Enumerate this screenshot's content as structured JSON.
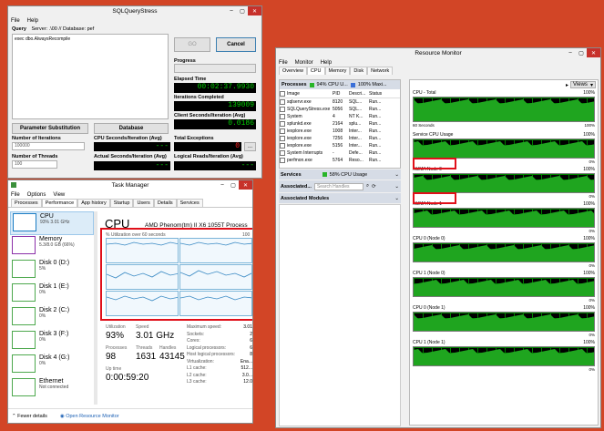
{
  "sqlqs": {
    "title": "SQLQueryStress",
    "menu": [
      "File",
      "Help"
    ],
    "query_label": "Query",
    "server_info": "Server: .\\00  //  Database: pef",
    "query_text": "exec dbo.AlwaysRecompile",
    "go_label": "GO",
    "cancel_label": "Cancel",
    "progress_label": "Progress",
    "elapsed_label": "Elapsed Time",
    "elapsed_value": "00:02:37.9930",
    "iterations_completed_label": "Iterations Completed",
    "iterations_completed_value": "139009",
    "client_seconds_label": "Client Seconds/Iteration (Avg)",
    "client_seconds_value": "0.0186",
    "param_sub_label": "Parameter Substitution",
    "database_label": "Database",
    "num_iter_label": "Number of Iterations",
    "num_iter_value": "100000",
    "cpu_seconds_label": "CPU Seconds/Iteration (Avg)",
    "cpu_seconds_value": "---",
    "total_exceptions_label": "Total Exceptions",
    "total_exceptions_value": "0",
    "ellipsis_label": "...",
    "num_threads_label": "Number of Threads",
    "num_threads_value": "100",
    "actual_seconds_label": "Actual Seconds/Iteration (Avg)",
    "actual_seconds_value": "---",
    "logical_reads_label": "Logical Reads/Iteration (Avg)",
    "logical_reads_value": "---"
  },
  "taskmgr": {
    "title": "Task Manager",
    "menu": [
      "File",
      "Options",
      "View"
    ],
    "tabs": [
      "Processes",
      "Performance",
      "App history",
      "Startup",
      "Users",
      "Details",
      "Services"
    ],
    "sidebar": [
      {
        "name": "CPU",
        "sub": "93%  3.01 GHz"
      },
      {
        "name": "Memory",
        "sub": "5.3/8.0 GB (66%)"
      },
      {
        "name": "Disk 0 (D:)",
        "sub": "5%"
      },
      {
        "name": "Disk 1 (E:)",
        "sub": "0%"
      },
      {
        "name": "Disk 2 (C:)",
        "sub": "0%"
      },
      {
        "name": "Disk 3 (F:)",
        "sub": "0%"
      },
      {
        "name": "Disk 4 (G:)",
        "sub": "0%"
      },
      {
        "name": "Ethernet",
        "sub": "Not connected"
      }
    ],
    "cpu_heading": "CPU",
    "cpu_model": "AMD Phenom(tm) II X6 1055T Process",
    "graph_label": "% Utilization over 60 seconds",
    "graph_max": "100",
    "utilization_label": "Utilization",
    "utilization_value": "93%",
    "speed_label": "Speed",
    "speed_value": "3.01 GHz",
    "processes_label": "Processes",
    "processes_value": "98",
    "threads_label": "Threads",
    "threads_value": "1631",
    "handles_label": "Handles",
    "handles_value": "43145",
    "uptime_label": "Up time",
    "uptime_value": "0:00:59:20",
    "details": [
      {
        "k": "Maximum speed:",
        "v": "3.01"
      },
      {
        "k": "Sockets:",
        "v": "2"
      },
      {
        "k": "Cores:",
        "v": "6"
      },
      {
        "k": "Logical processors:",
        "v": "6"
      },
      {
        "k": "Host logical processors:",
        "v": "8"
      },
      {
        "k": "Virtualization:",
        "v": "Ena..."
      },
      {
        "k": "L1 cache:",
        "v": "512..."
      },
      {
        "k": "L2 cache:",
        "v": "3.0..."
      },
      {
        "k": "L3 cache:",
        "v": "12.0"
      }
    ],
    "fewer_details": "Fewer details",
    "open_resmon": "Open Resource Monitor"
  },
  "resmon": {
    "title": "Resource Monitor",
    "menu": [
      "File",
      "Monitor",
      "Help"
    ],
    "tabs": [
      "Overview",
      "CPU",
      "Memory",
      "Disk",
      "Network"
    ],
    "processes_label": "Processes",
    "processes_cpu": "94% CPU U...",
    "processes_max": "100% Maxi...",
    "columns": [
      "Image",
      "PID",
      "Descri...",
      "Status"
    ],
    "rows": [
      {
        "image": "sqlservr.exe",
        "pid": "8120",
        "desc": "SQL...",
        "status": "Run..."
      },
      {
        "image": "SQLQueryStress.exe",
        "pid": "5056",
        "desc": "SQL...",
        "status": "Run..."
      },
      {
        "image": "System",
        "pid": "4",
        "desc": "NT K...",
        "status": "Run..."
      },
      {
        "image": "splunkd.exe",
        "pid": "2164",
        "desc": "splu...",
        "status": "Run..."
      },
      {
        "image": "iexplore.exe",
        "pid": "1008",
        "desc": "Inter...",
        "status": "Run..."
      },
      {
        "image": "iexplore.exe",
        "pid": "7256",
        "desc": "Inter...",
        "status": "Run..."
      },
      {
        "image": "iexplore.exe",
        "pid": "5156",
        "desc": "Inter...",
        "status": "Run..."
      },
      {
        "image": "System Interrupts",
        "pid": "-",
        "desc": "Defe...",
        "status": "Run..."
      },
      {
        "image": "perfmon.exe",
        "pid": "5764",
        "desc": "Reso...",
        "status": "Run..."
      }
    ],
    "services_label": "Services",
    "services_cpu": "58% CPU Usage",
    "associated_label": "Associated...",
    "search_placeholder": "Search Handles",
    "modules_label": "Associated Modules",
    "views_label": "Views",
    "graphs": [
      {
        "title": "CPU - Total",
        "max": "100%",
        "footer_left": "60 Seconds",
        "footer_right": "100%"
      },
      {
        "title": "Service CPU Usage",
        "max": "100%",
        "footer_left": "",
        "footer_right": "0%"
      },
      {
        "title": "NUMA Node 0",
        "max": "100%",
        "footer_left": "",
        "footer_right": "0%"
      },
      {
        "title": "NUMA Node 1",
        "max": "100%",
        "footer_left": "",
        "footer_right": "0%"
      },
      {
        "title": "CPU 0 (Node 0)",
        "max": "100%",
        "footer_left": "",
        "footer_right": "0%"
      },
      {
        "title": "CPU 1 (Node 0)",
        "max": "100%",
        "footer_left": "",
        "footer_right": "0%"
      },
      {
        "title": "CPU 0 (Node 1)",
        "max": "100%",
        "footer_left": "",
        "footer_right": "0%"
      },
      {
        "title": "CPU 1 (Node 1)",
        "max": "100%",
        "footer_left": "",
        "footer_right": "0%"
      }
    ]
  },
  "colors": {
    "desktop": "#d24526",
    "highlight": "#e0101a",
    "lcd_green": "#00d000"
  }
}
